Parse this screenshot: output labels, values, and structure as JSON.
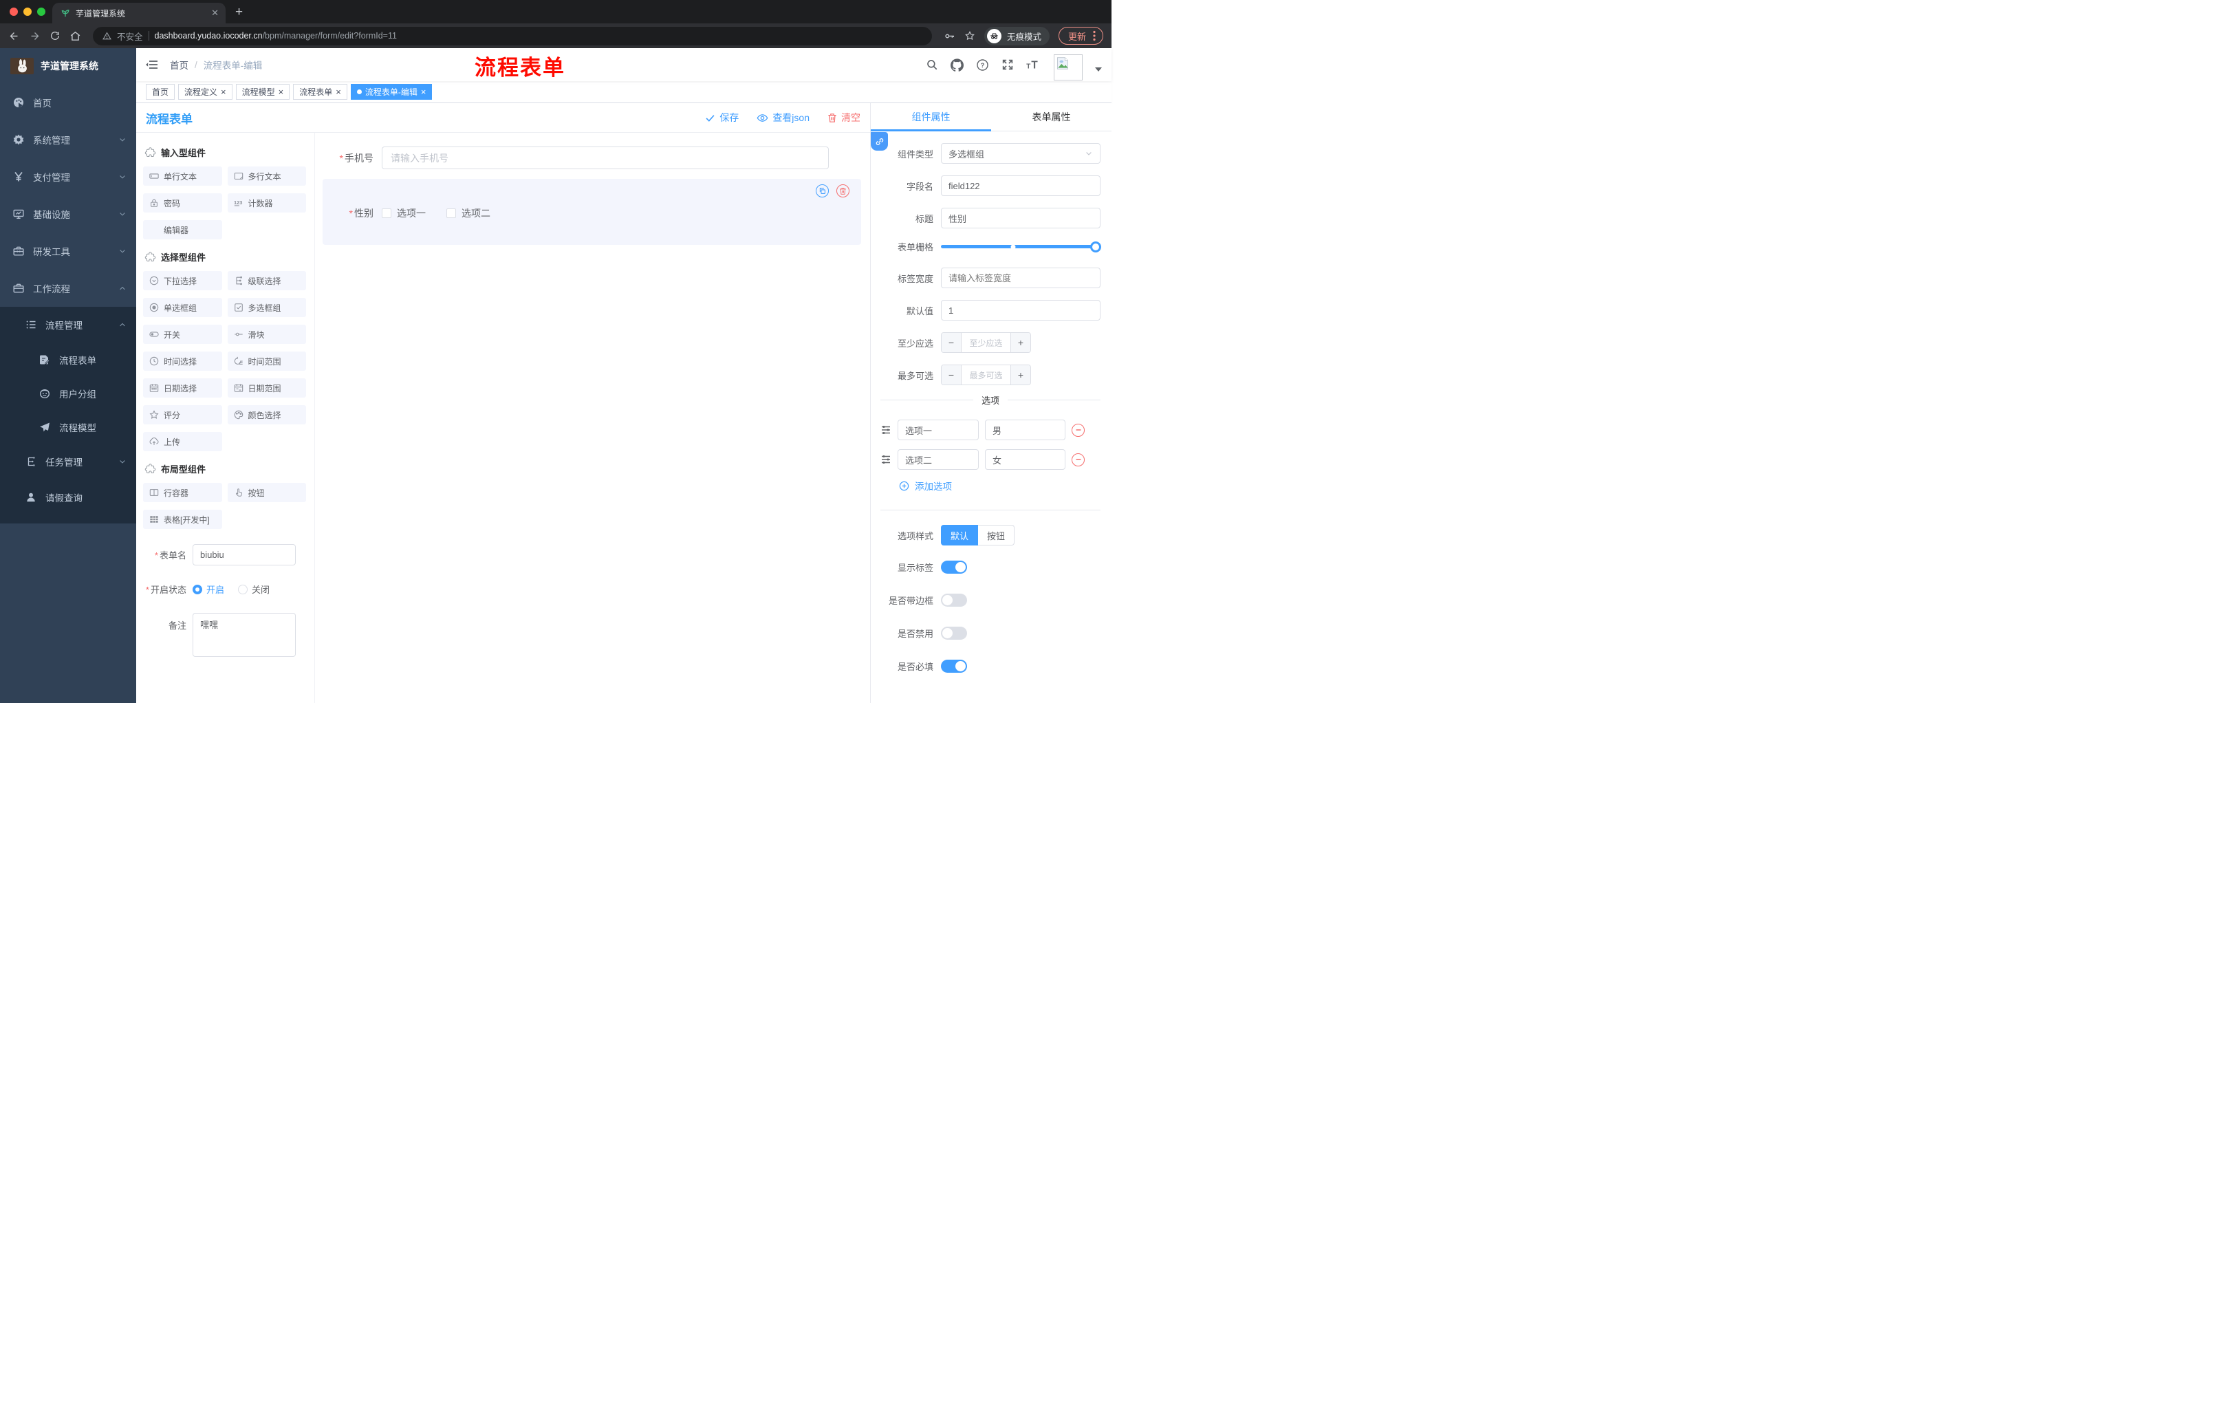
{
  "browser": {
    "tab_title": "芋道管理系统",
    "not_secure": "不安全",
    "url_host": "dashboard.yudao.iocoder.cn",
    "url_path": "/bpm/manager/form/edit?formId=11",
    "incognito_label": "无痕模式",
    "update_label": "更新"
  },
  "sidebar": {
    "brand": "芋道管理系统",
    "menu": [
      {
        "label": "首页"
      },
      {
        "label": "系统管理"
      },
      {
        "label": "支付管理"
      },
      {
        "label": "基础设施"
      },
      {
        "label": "研发工具"
      },
      {
        "label": "工作流程"
      }
    ],
    "submenu": [
      {
        "label": "流程管理"
      },
      {
        "label": "流程表单"
      },
      {
        "label": "用户分组"
      },
      {
        "label": "流程模型"
      },
      {
        "label": "任务管理"
      },
      {
        "label": "请假查询"
      }
    ]
  },
  "header": {
    "breadcrumb_home": "首页",
    "breadcrumb_current": "流程表单-编辑",
    "annotation": "流程表单"
  },
  "tags": [
    {
      "label": "首页"
    },
    {
      "label": "流程定义"
    },
    {
      "label": "流程模型"
    },
    {
      "label": "流程表单"
    },
    {
      "label": "流程表单-编辑"
    }
  ],
  "designer": {
    "title": "流程表单",
    "save": "保存",
    "view_json": "查看json",
    "clear": "清空",
    "sections": [
      {
        "title": "输入型组件",
        "items": [
          {
            "label": "单行文本"
          },
          {
            "label": "多行文本"
          },
          {
            "label": "密码"
          },
          {
            "label": "计数器"
          },
          {
            "label": "编辑器"
          }
        ]
      },
      {
        "title": "选择型组件",
        "items": [
          {
            "label": "下拉选择"
          },
          {
            "label": "级联选择"
          },
          {
            "label": "单选框组"
          },
          {
            "label": "多选框组"
          },
          {
            "label": "开关"
          },
          {
            "label": "滑块"
          },
          {
            "label": "时间选择"
          },
          {
            "label": "时间范围"
          },
          {
            "label": "日期选择"
          },
          {
            "label": "日期范围"
          },
          {
            "label": "评分"
          },
          {
            "label": "颜色选择"
          },
          {
            "label": "上传"
          }
        ]
      },
      {
        "title": "布局型组件",
        "items": [
          {
            "label": "行容器"
          },
          {
            "label": "按钮"
          },
          {
            "label": "表格[开发中]"
          }
        ]
      }
    ],
    "meta": {
      "form_name_label": "表单名",
      "form_name_value": "biubiu",
      "status_label": "开启状态",
      "status_on": "开启",
      "status_off": "关闭",
      "remark_label": "备注",
      "remark_value": "嘿嘿"
    },
    "canvas": {
      "phone_label": "手机号",
      "phone_placeholder": "请输入手机号",
      "gender_label": "性别",
      "gender_option1": "选项一",
      "gender_option2": "选项二"
    }
  },
  "panel": {
    "tab_component": "组件属性",
    "tab_form": "表单属性",
    "component_type_label": "组件类型",
    "component_type_value": "多选框组",
    "field_name_label": "字段名",
    "field_name_value": "field122",
    "title_label": "标题",
    "title_value": "性别",
    "grid_label": "表单栅格",
    "label_width_label": "标签宽度",
    "label_width_placeholder": "请输入标签宽度",
    "default_label": "默认值",
    "default_value": "1",
    "min_label": "至少应选",
    "min_placeholder": "至少应选",
    "max_label": "最多可选",
    "max_placeholder": "最多可选",
    "options_divider": "选项",
    "options": [
      {
        "label": "选项一",
        "value": "男"
      },
      {
        "label": "选项二",
        "value": "女"
      }
    ],
    "add_option": "添加选项",
    "style_label": "选项样式",
    "style_default": "默认",
    "style_button": "按钮",
    "toggle_show_label": "显示标签",
    "toggle_border": "是否带边框",
    "toggle_disabled": "是否禁用",
    "toggle_required": "是否必填"
  },
  "colors": {
    "primary": "#409eff",
    "danger": "#f56c6c",
    "annotation_red": "#fe0b01",
    "sidebar_bg": "#304156",
    "submenu_bg": "#1f2d3d"
  }
}
